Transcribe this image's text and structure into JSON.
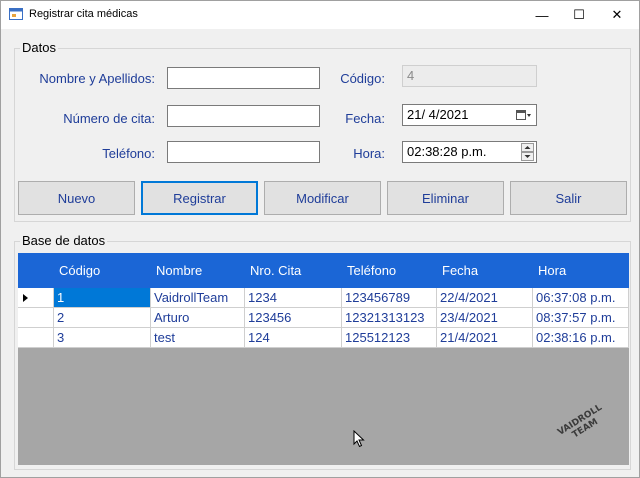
{
  "window": {
    "title": "Registrar cita médicas",
    "minimize": "—",
    "maximize": "☐",
    "close": "✕"
  },
  "datos": {
    "legend": "Datos",
    "nombre_label": "Nombre y Apellidos:",
    "nombre_value": "",
    "numero_label": "Número de cita:",
    "numero_value": "",
    "telefono_label": "Teléfono:",
    "telefono_value": "",
    "codigo_label": "Código:",
    "codigo_value": "4",
    "fecha_label": "Fecha:",
    "fecha_value": "21/  4/2021",
    "hora_label": "Hora:",
    "hora_value": "02:38:28 p.m."
  },
  "buttons": {
    "nuevo": "Nuevo",
    "registrar": "Registrar",
    "modificar": "Modificar",
    "eliminar": "Eliminar",
    "salir": "Salir"
  },
  "base": {
    "legend": "Base de datos",
    "columns": [
      "Código",
      "Nombre",
      "Nro. Cita",
      "Teléfono",
      "Fecha",
      "Hora"
    ],
    "rows": [
      [
        "1",
        "VaidrollTeam",
        "1234",
        "123456789",
        "22/4/2021",
        "06:37:08 p.m."
      ],
      [
        "2",
        "Arturo",
        "123456",
        "12321313123",
        "23/4/2021",
        "08:37:57 p.m."
      ],
      [
        "3",
        "test",
        "124",
        "125512123",
        "21/4/2021",
        "02:38:16 p.m."
      ]
    ]
  },
  "watermark": "VAIDROLL TEAM",
  "colors": {
    "header_blue": "#1b66d6",
    "selection_blue": "#0078d7",
    "label_blue": "#1f3d99",
    "grid_gray": "#a6a6a6"
  },
  "icons": {
    "app": "app-form-icon",
    "calendar": "calendar-dropdown-icon",
    "spin": "spin-updown-icon",
    "row_pointer": "row-pointer-icon",
    "cursor": "mouse-cursor-icon"
  }
}
